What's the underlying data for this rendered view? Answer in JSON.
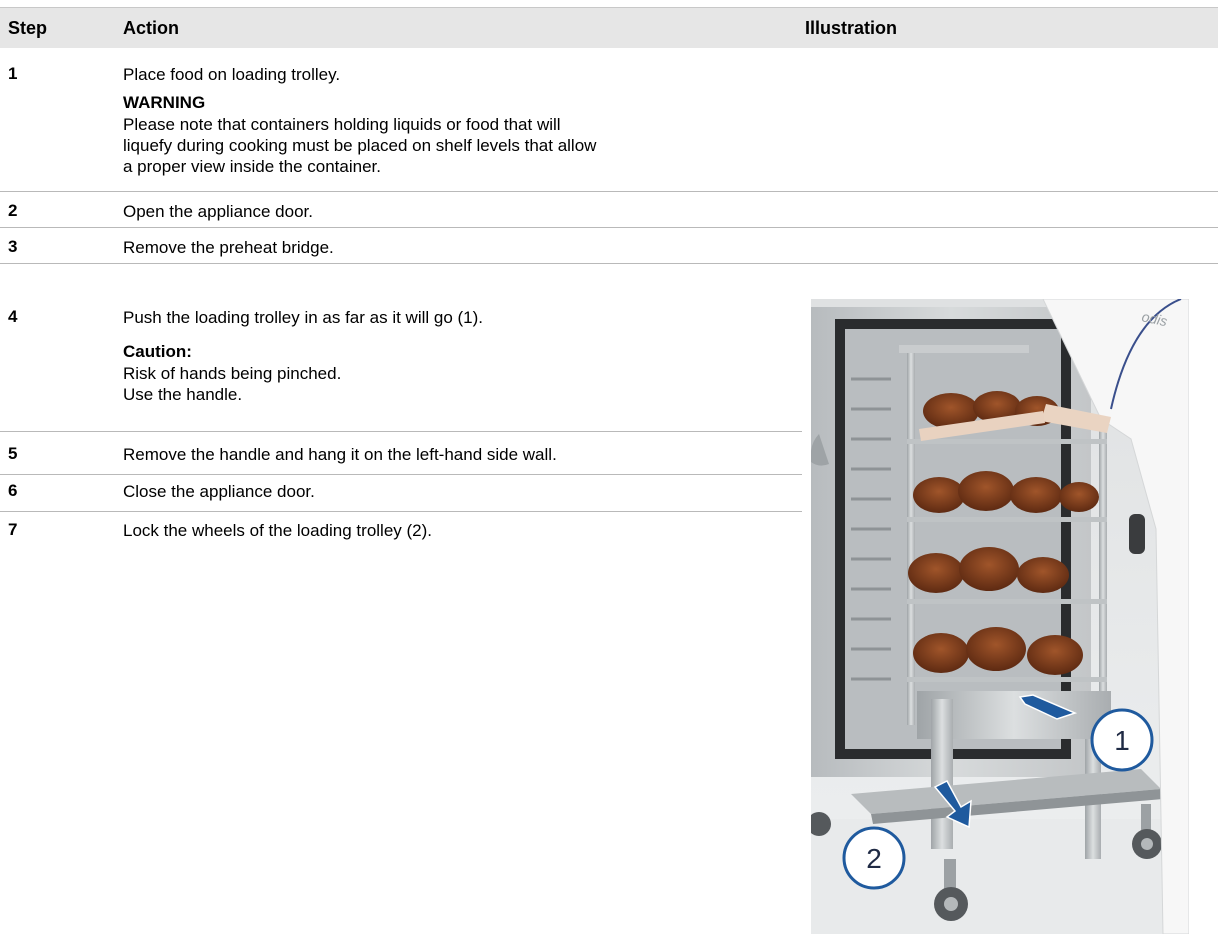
{
  "table": {
    "headers": {
      "step": "Step",
      "action": "Action",
      "illustration": "Illustration"
    },
    "rows": [
      {
        "step": "1",
        "action": "Place food on loading trolley.",
        "note_title": "WARNING",
        "note_lines": [
          "Please note that containers holding liquids or food that will",
          "liquefy during cooking must be placed on shelf levels that allow",
          "a proper view inside the container."
        ]
      },
      {
        "step": "2",
        "action": "Open the appliance door."
      },
      {
        "step": "3",
        "action": "Remove the preheat bridge."
      },
      {
        "step": "4",
        "action": "Push the loading trolley in as far as it will go (1).",
        "note_title": "Caution:",
        "note_lines": [
          "Risk of hands being pinched.",
          "Use the handle."
        ]
      },
      {
        "step": "5",
        "action": "Remove the handle and hang it on the left-hand side wall."
      },
      {
        "step": "6",
        "action": "Close the appliance door."
      },
      {
        "step": "7",
        "action": "Lock the wheels of the loading trolley (2)."
      }
    ]
  },
  "illustration": {
    "callout_1": "1",
    "callout_2": "2",
    "watermark": "odis",
    "colors": {
      "arrow": "#1f5a9e",
      "steel": "#c9ccce",
      "food": "#7a3a1c",
      "chef": "#f7f7f7"
    }
  }
}
